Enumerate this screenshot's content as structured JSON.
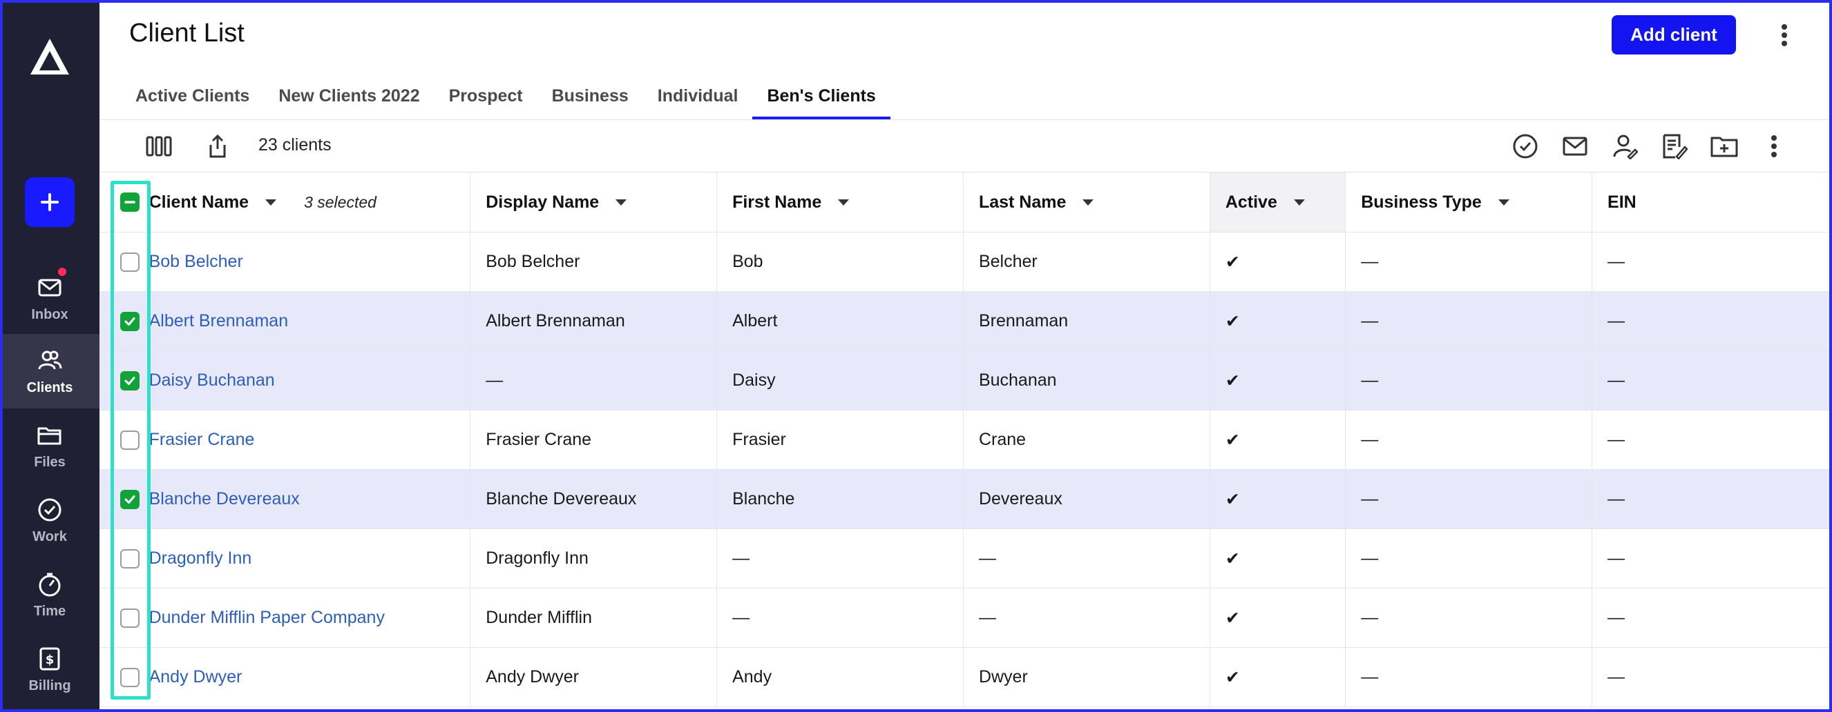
{
  "sidebar": {
    "items": [
      {
        "label": "Inbox",
        "icon": "mail-icon",
        "has_notification": true
      },
      {
        "label": "Clients",
        "icon": "clients-icon",
        "active": true
      },
      {
        "label": "Files",
        "icon": "folder-icon"
      },
      {
        "label": "Work",
        "icon": "check-circle-icon"
      },
      {
        "label": "Time",
        "icon": "timer-icon"
      },
      {
        "label": "Billing",
        "icon": "billing-icon"
      }
    ],
    "add_icon": "plus-icon"
  },
  "header": {
    "title": "Client List",
    "add_client_label": "Add client"
  },
  "tabs": [
    {
      "label": "Active Clients"
    },
    {
      "label": "New Clients 2022"
    },
    {
      "label": "Prospect"
    },
    {
      "label": "Business"
    },
    {
      "label": "Individual"
    },
    {
      "label": "Ben's Clients",
      "active": true
    }
  ],
  "toolbar": {
    "count": "23 clients",
    "right_icons": [
      "check-circle-icon",
      "mail-icon",
      "assign-user-icon",
      "edit-note-icon",
      "add-folder-icon",
      "more-vertical-icon"
    ]
  },
  "table": {
    "columns": {
      "client_name": "Client Name",
      "selected_count": "3 selected",
      "display_name": "Display Name",
      "first_name": "First Name",
      "last_name": "Last Name",
      "active": "Active",
      "business_type": "Business Type",
      "ein": "EIN"
    },
    "rows": [
      {
        "client_name": "Bob Belcher",
        "display_name": "Bob Belcher",
        "first_name": "Bob",
        "last_name": "Belcher",
        "active": "✔",
        "business_type": "—",
        "ein": "—",
        "selected": false
      },
      {
        "client_name": "Albert Brennaman",
        "display_name": "Albert Brennaman",
        "first_name": "Albert",
        "last_name": "Brennaman",
        "active": "✔",
        "business_type": "—",
        "ein": "—",
        "selected": true
      },
      {
        "client_name": "Daisy Buchanan",
        "display_name": "—",
        "first_name": "Daisy",
        "last_name": "Buchanan",
        "active": "✔",
        "business_type": "—",
        "ein": "—",
        "selected": true
      },
      {
        "client_name": "Frasier Crane",
        "display_name": "Frasier Crane",
        "first_name": "Frasier",
        "last_name": "Crane",
        "active": "✔",
        "business_type": "—",
        "ein": "—",
        "selected": false
      },
      {
        "client_name": "Blanche Devereaux",
        "display_name": "Blanche Devereaux",
        "first_name": "Blanche",
        "last_name": "Devereaux",
        "active": "✔",
        "business_type": "—",
        "ein": "—",
        "selected": true
      },
      {
        "client_name": "Dragonfly Inn",
        "display_name": "Dragonfly Inn",
        "first_name": "—",
        "last_name": "—",
        "active": "✔",
        "business_type": "—",
        "ein": "—",
        "selected": false
      },
      {
        "client_name": "Dunder Mifflin Paper Company",
        "display_name": "Dunder Mifflin",
        "first_name": "—",
        "last_name": "—",
        "active": "✔",
        "business_type": "—",
        "ein": "—",
        "selected": false
      },
      {
        "client_name": "Andy Dwyer",
        "display_name": "Andy Dwyer",
        "first_name": "Andy",
        "last_name": "Dwyer",
        "active": "✔",
        "business_type": "—",
        "ein": "—",
        "selected": false
      }
    ]
  },
  "colors": {
    "accent": "#1a1aff",
    "sidebar_bg": "#1f2033",
    "check_green": "#11a339",
    "selected_row": "#e8e8fb",
    "highlight": "#2ee0c8",
    "link": "#2d5fb8"
  }
}
